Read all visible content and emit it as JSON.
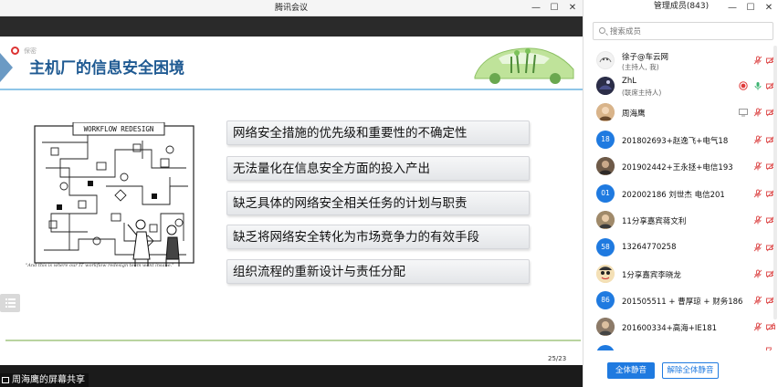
{
  "meeting": {
    "title": "腾讯会议",
    "share_label": "周海鹰的屏幕共享",
    "window_controls": [
      "minimize-icon",
      "maximize-icon",
      "close-icon"
    ]
  },
  "slide": {
    "tag": "保密",
    "title": "主机厂的信息安全困境",
    "bullets": [
      "网络安全措施的优先级和重要性的不确定性",
      "无法量化在信息安全方面的投入产出",
      "缺乏具体的网络安全相关任务的计划与职责",
      "缺乏将网络安全转化为市场竞争力的有效手段",
      "组织流程的重新设计与责任分配"
    ],
    "cartoon_heading": "WORKFLOW REDESIGN",
    "cartoon_caption": "\"And this is where our IT workflow redesign team went insane.\"",
    "page": "25/23"
  },
  "panel": {
    "title": "管理成员(843)",
    "search_placeholder": "搜索成员",
    "participants": [
      {
        "name": "徐子@车云网",
        "role": "(主持人, 我)",
        "avatar": "doodle",
        "recording": false,
        "mic": "muted",
        "sharing": false
      },
      {
        "name": "ZhL",
        "role": "(联席主持人)",
        "avatar": "dark",
        "recording": true,
        "mic": "on",
        "sharing": false
      },
      {
        "name": "周海鹰",
        "role": "",
        "avatar": "photo",
        "recording": false,
        "mic": "muted",
        "sharing": true
      },
      {
        "name": "201802693+赵逸飞+电气18",
        "role": "",
        "avatar": "18",
        "mic": "muted"
      },
      {
        "name": "201902442+王永拯+电信193",
        "role": "",
        "avatar": "photo",
        "mic": "muted"
      },
      {
        "name": "202002186 刘世杰 电信201",
        "role": "",
        "avatar": "01",
        "mic": "muted"
      },
      {
        "name": "11分享嘉宾蒋文利",
        "role": "",
        "avatar": "photo",
        "mic": "muted"
      },
      {
        "name": "13264770258",
        "role": "",
        "avatar": "58",
        "mic": "muted"
      },
      {
        "name": "1分享嘉宾李晓龙",
        "role": "",
        "avatar": "cartoon",
        "mic": "muted"
      },
      {
        "name": "201505511 + 曹厚琼 + 财务186",
        "role": "",
        "avatar": "86",
        "mic": "muted"
      },
      {
        "name": "201600334+高海+IE181",
        "role": "",
        "avatar": "photo",
        "mic": "muted"
      }
    ],
    "mute_all": "全体静音",
    "unmute_all": "解除全体静音",
    "colors": {
      "accent": "#1f7ae0",
      "muted": "#e05a5a",
      "mic_on": "#3cb371",
      "recording": "#e03a3a"
    }
  }
}
